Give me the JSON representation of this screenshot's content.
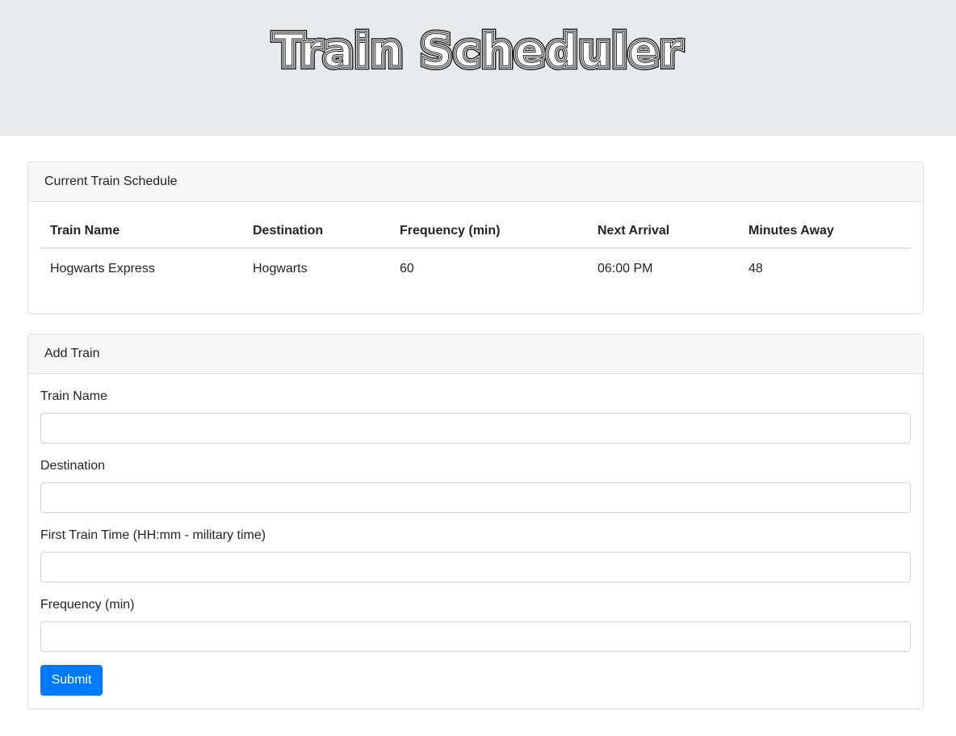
{
  "header": {
    "title": "Train Scheduler"
  },
  "schedule": {
    "heading": "Current Train Schedule",
    "columns": [
      "Train Name",
      "Destination",
      "Frequency (min)",
      "Next Arrival",
      "Minutes Away"
    ],
    "rows": [
      [
        "Hogwarts Express",
        "Hogwarts",
        "60",
        "06:00 PM",
        "48"
      ]
    ]
  },
  "add_train": {
    "heading": "Add Train",
    "fields": [
      {
        "label": "Train Name",
        "value": ""
      },
      {
        "label": "Destination",
        "value": ""
      },
      {
        "label": "First Train Time (HH:mm - military time)",
        "value": ""
      },
      {
        "label": "Frequency (min)",
        "value": ""
      }
    ],
    "submit_label": "Submit"
  },
  "colors": {
    "jumbotron_bg": "#e8ebee",
    "primary": "#007bff"
  }
}
